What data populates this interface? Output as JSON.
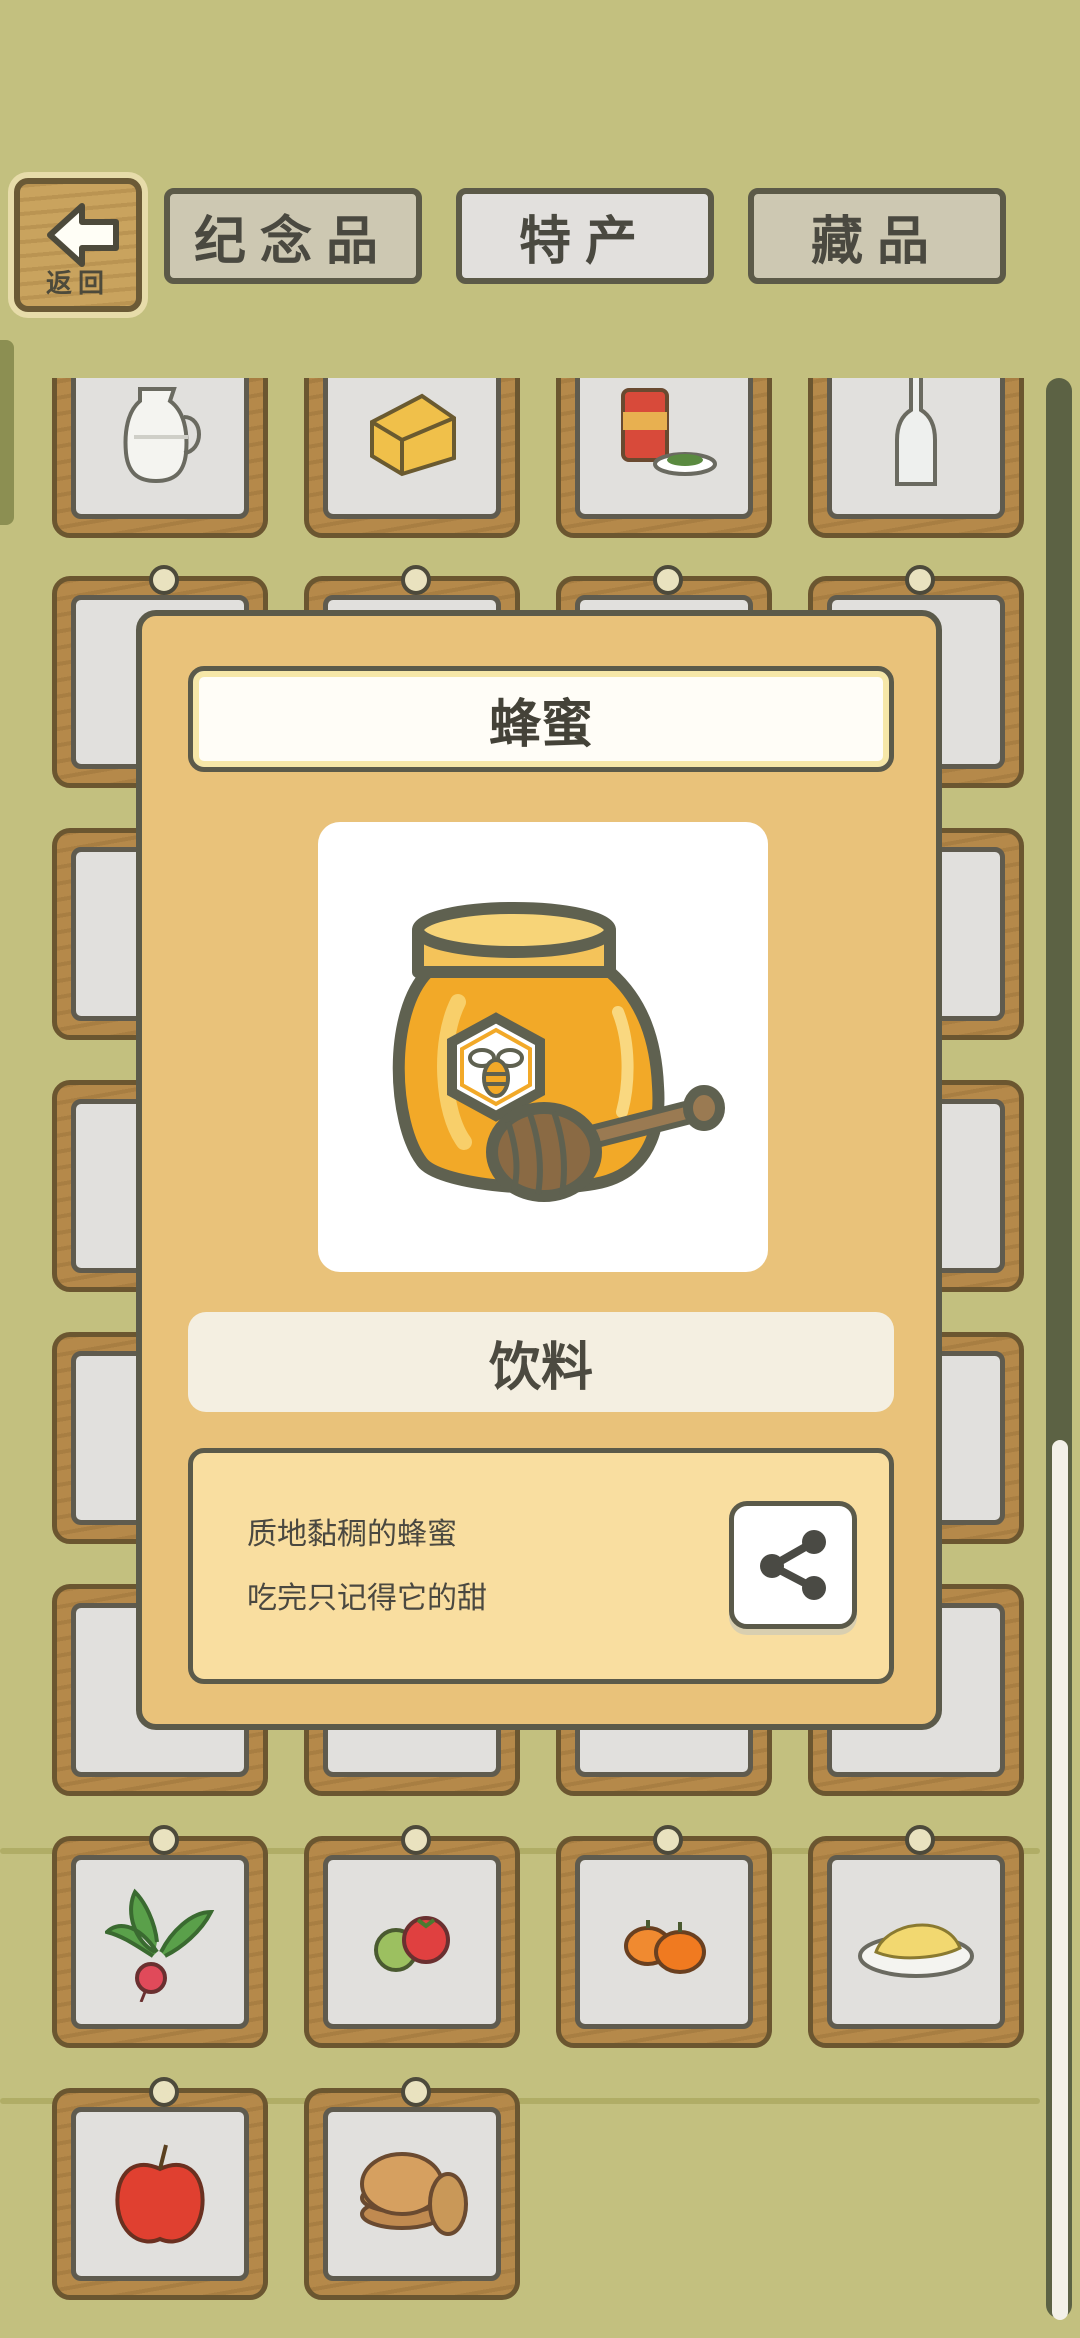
{
  "header": {
    "back_label": "返回",
    "tabs": [
      {
        "label": "纪念品",
        "state": "inactive"
      },
      {
        "label": "特产",
        "state": "active"
      },
      {
        "label": "藏品",
        "state": "inactive"
      }
    ]
  },
  "grid_items": [
    "milk-jug-icon",
    "cheese-icon",
    "tea-canister-icon",
    "glass-bottle-icon",
    "radish-icon",
    "tomato-icon",
    "pumpkin-icon",
    "pasta-plate-icon",
    "apple-icon",
    "pancake-stack-icon"
  ],
  "dialog": {
    "title": "蜂蜜",
    "image_icon": "honey-jar-icon",
    "category": "饮料",
    "description": [
      "质地黏稠的蜂蜜",
      "吃完只记得它的甜"
    ],
    "share_icon": "share-icon"
  },
  "colors": {
    "background": "#c3c07f",
    "dialog": "#e9c27a",
    "card_wood": "#b5894a",
    "honey": "#f2a928"
  }
}
